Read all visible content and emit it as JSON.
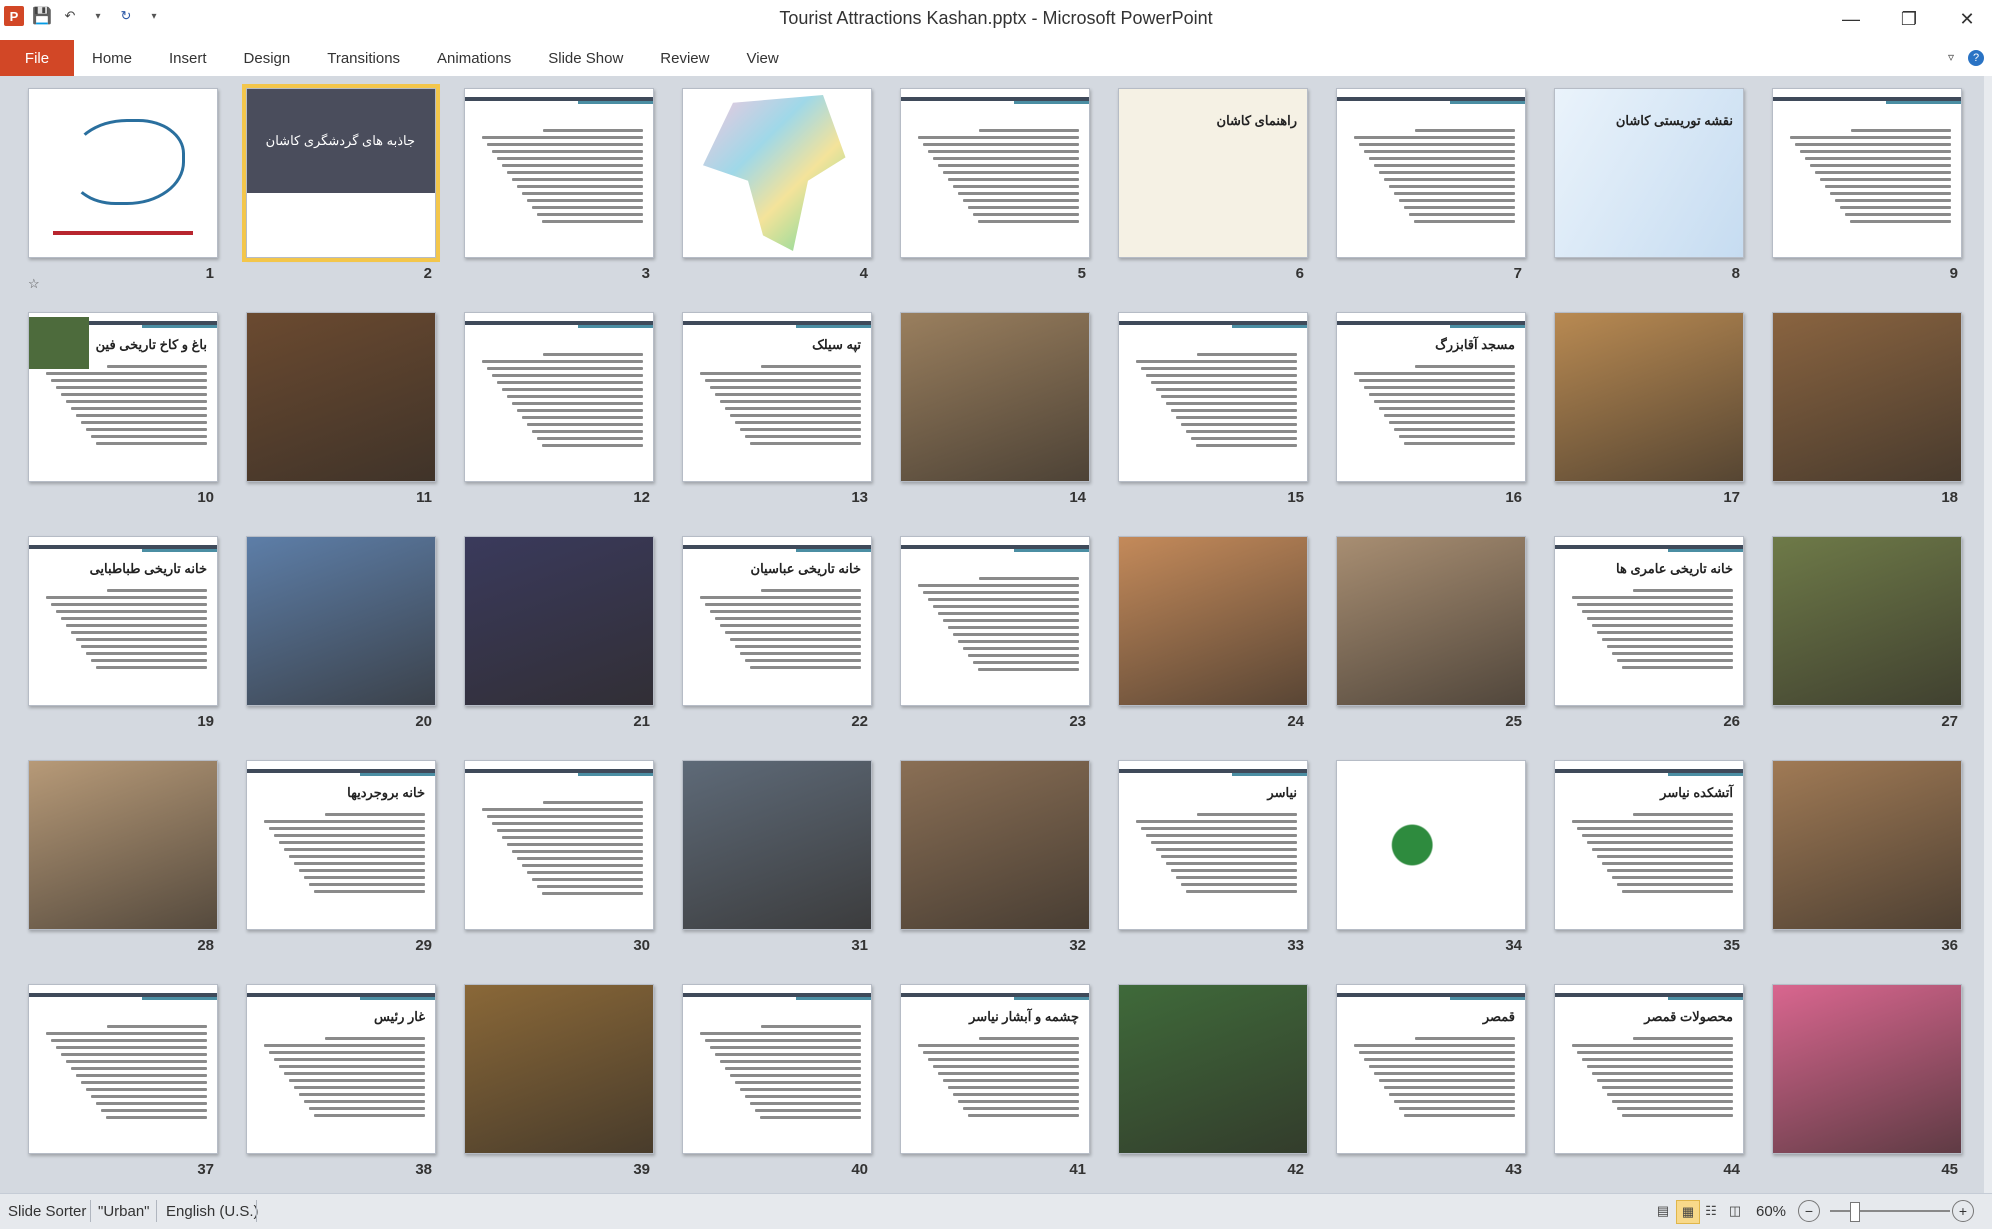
{
  "window": {
    "title": "Tourist Attractions Kashan.pptx - Microsoft PowerPoint",
    "app_logo": "P"
  },
  "ribbon": {
    "file_tab": "File",
    "tabs": [
      "Home",
      "Insert",
      "Design",
      "Transitions",
      "Animations",
      "Slide Show",
      "Review",
      "View"
    ]
  },
  "slides": [
    {
      "n": "1",
      "kind": "calligraphy"
    },
    {
      "n": "2",
      "kind": "title",
      "title": "جاذبه های گردشگری کاشان",
      "selected": true
    },
    {
      "n": "3",
      "kind": "text"
    },
    {
      "n": "4",
      "kind": "map-color"
    },
    {
      "n": "5",
      "kind": "text"
    },
    {
      "n": "6",
      "kind": "map-city",
      "title": "راهنمای کاشان"
    },
    {
      "n": "7",
      "kind": "text"
    },
    {
      "n": "8",
      "kind": "map-plan",
      "title": "نقشه توریستی کاشان"
    },
    {
      "n": "9",
      "kind": "text"
    },
    {
      "n": "10",
      "kind": "text-image",
      "title": "باغ و کاخ تاریخی فین"
    },
    {
      "n": "11",
      "kind": "photo",
      "color": "#6b4a30"
    },
    {
      "n": "12",
      "kind": "text"
    },
    {
      "n": "13",
      "kind": "text",
      "title": "تپه سیلک"
    },
    {
      "n": "14",
      "kind": "photo",
      "color": "#9a7f5e"
    },
    {
      "n": "15",
      "kind": "text"
    },
    {
      "n": "16",
      "kind": "text",
      "title": "مسجد آقابزرگ"
    },
    {
      "n": "17",
      "kind": "photo",
      "color": "#b98a52"
    },
    {
      "n": "18",
      "kind": "photo",
      "color": "#8a6440"
    },
    {
      "n": "19",
      "kind": "text",
      "title": "خانه تاریخی طباطبایی"
    },
    {
      "n": "20",
      "kind": "photo",
      "color": "#5d7ea8"
    },
    {
      "n": "21",
      "kind": "photo",
      "color": "#3a3a5c"
    },
    {
      "n": "22",
      "kind": "text",
      "title": "خانه تاریخی عباسیان"
    },
    {
      "n": "23",
      "kind": "text"
    },
    {
      "n": "24",
      "kind": "photo",
      "color": "#c48a5a"
    },
    {
      "n": "25",
      "kind": "photo",
      "color": "#a88e72"
    },
    {
      "n": "26",
      "kind": "text",
      "title": "خانه تاریخی عامری ها"
    },
    {
      "n": "27",
      "kind": "photo",
      "color": "#6e7a48"
    },
    {
      "n": "28",
      "kind": "photo",
      "color": "#b79a78"
    },
    {
      "n": "29",
      "kind": "text",
      "title": "خانه بروجردیها"
    },
    {
      "n": "30",
      "kind": "text"
    },
    {
      "n": "31",
      "kind": "photo",
      "color": "#5e6a78"
    },
    {
      "n": "32",
      "kind": "photo",
      "color": "#8a6f55"
    },
    {
      "n": "33",
      "kind": "text",
      "title": "نیاسر"
    },
    {
      "n": "34",
      "kind": "map-route"
    },
    {
      "n": "35",
      "kind": "text",
      "title": "آتشکده نیاسر"
    },
    {
      "n": "36",
      "kind": "photo",
      "color": "#a07a55"
    },
    {
      "n": "37",
      "kind": "text"
    },
    {
      "n": "38",
      "kind": "text",
      "title": "غار رئیس"
    },
    {
      "n": "39",
      "kind": "photo",
      "color": "#8a6838"
    },
    {
      "n": "40",
      "kind": "text"
    },
    {
      "n": "41",
      "kind": "text",
      "title": "چشمه و آبشار نیاسر"
    },
    {
      "n": "42",
      "kind": "photo",
      "color": "#3f6a3a"
    },
    {
      "n": "43",
      "kind": "text",
      "title": "قمصر"
    },
    {
      "n": "44",
      "kind": "text",
      "title": "محصولات قمصر"
    },
    {
      "n": "45",
      "kind": "photo",
      "color": "#d9668f"
    }
  ],
  "status": {
    "view": "Slide Sorter",
    "theme": "\"Urban\"",
    "language": "English (U.S.)",
    "zoom": "60%"
  }
}
